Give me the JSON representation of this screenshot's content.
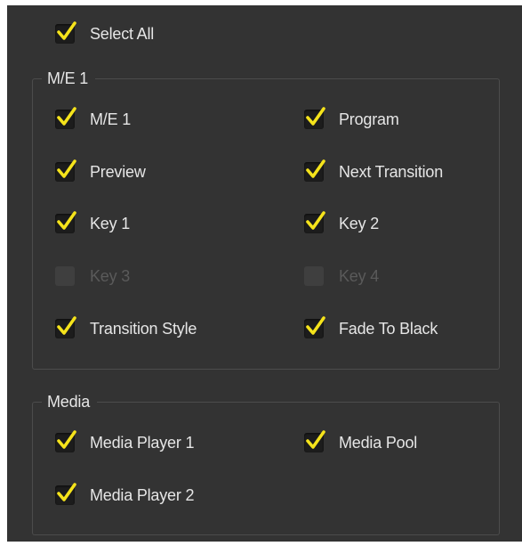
{
  "select_all": {
    "label": "Select All",
    "checked": true
  },
  "groups": [
    {
      "title": "M/E 1",
      "items": [
        {
          "label": "M/E 1",
          "checked": true,
          "enabled": true
        },
        {
          "label": "Program",
          "checked": true,
          "enabled": true
        },
        {
          "label": "Preview",
          "checked": true,
          "enabled": true
        },
        {
          "label": "Next Transition",
          "checked": true,
          "enabled": true
        },
        {
          "label": "Key 1",
          "checked": true,
          "enabled": true
        },
        {
          "label": "Key 2",
          "checked": true,
          "enabled": true
        },
        {
          "label": "Key 3",
          "checked": false,
          "enabled": false
        },
        {
          "label": "Key 4",
          "checked": false,
          "enabled": false
        },
        {
          "label": "Transition Style",
          "checked": true,
          "enabled": true
        },
        {
          "label": "Fade To Black",
          "checked": true,
          "enabled": true
        }
      ]
    },
    {
      "title": "Media",
      "items": [
        {
          "label": "Media Player 1",
          "checked": true,
          "enabled": true
        },
        {
          "label": "Media Pool",
          "checked": true,
          "enabled": true
        },
        {
          "label": "Media Player 2",
          "checked": true,
          "enabled": true
        }
      ]
    }
  ],
  "colors": {
    "panel_background": "#333333",
    "checkmark": "#f5e31b",
    "label_text": "#e6e6e6",
    "disabled_text": "#5a5a5a"
  },
  "icons": {
    "checkmark": "checkmark-icon"
  }
}
